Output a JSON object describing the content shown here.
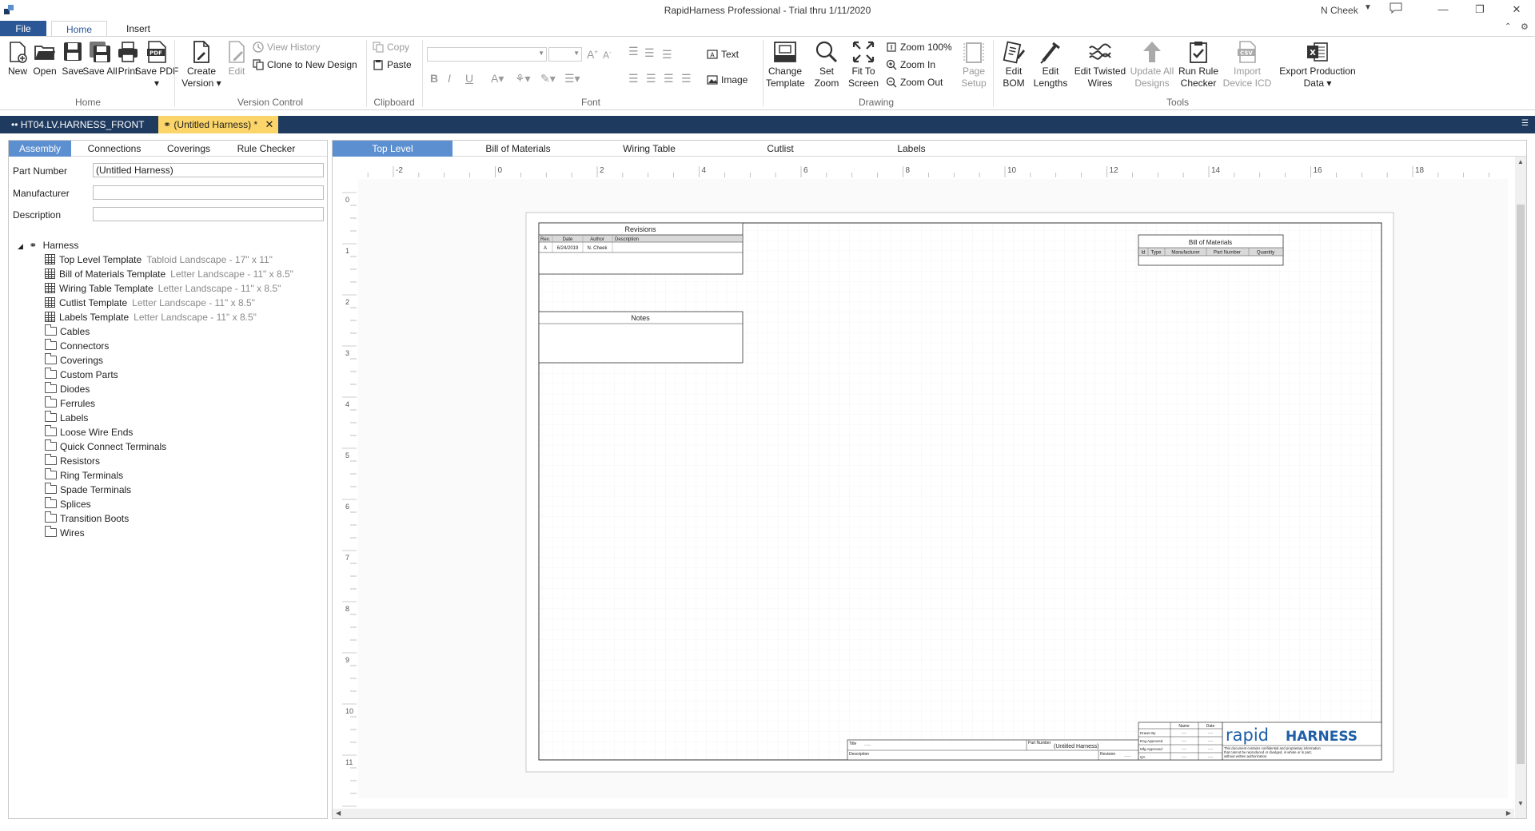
{
  "title": "RapidHarness Professional - Trial thru 1/11/2020",
  "user": "N Cheek",
  "ribbon_tabs": [
    "File",
    "Home",
    "Insert"
  ],
  "ribbon": {
    "home_group": {
      "label": "Home",
      "buttons": [
        "New",
        "Open",
        "Save",
        "Save All",
        "Print",
        "Save PDF ▾"
      ]
    },
    "version_group": {
      "label": "Version Control",
      "create_version": "Create Version ▾",
      "edit": "Edit",
      "view_history": "View History",
      "clone": "Clone to New Design"
    },
    "clipboard_group": {
      "label": "Clipboard",
      "copy": "Copy",
      "paste": "Paste"
    },
    "font_group": {
      "label": "Font",
      "text": "Text",
      "image": "Image"
    },
    "drawing_group": {
      "label": "Drawing",
      "change_template": "Change Template",
      "set_zoom": "Set Zoom",
      "fit_to_screen": "Fit To Screen",
      "zoom_100": "Zoom 100%",
      "zoom_in": "Zoom In",
      "zoom_out": "Zoom Out",
      "page_setup": "Page Setup"
    },
    "tools_group": {
      "label": "Tools",
      "edit_bom": "Edit BOM",
      "edit_lengths": "Edit Lengths",
      "edit_twisted": "Edit Twisted Wires",
      "update_all": "Update All Designs",
      "run_rule": "Run Rule Checker",
      "import_icd": "Import Device ICD",
      "export": "Export Production Data ▾"
    }
  },
  "doc_tabs": [
    {
      "label": "HT04.LV.HARNESS_FRONT",
      "active": false
    },
    {
      "label": "(Untitled Harness) *",
      "active": true
    }
  ],
  "left_panel": {
    "tabs": [
      "Assembly",
      "Connections",
      "Coverings",
      "Rule Checker"
    ],
    "fields": {
      "part_number_label": "Part Number",
      "part_number_value": "(Untitled Harness)",
      "manufacturer_label": "Manufacturer",
      "manufacturer_value": "",
      "description_label": "Description",
      "description_value": ""
    },
    "tree": {
      "root": "Harness",
      "templates": [
        {
          "label": "Top Level Template",
          "sub": "Tabloid Landscape - 17\" x 11\""
        },
        {
          "label": "Bill of Materials Template",
          "sub": "Letter Landscape - 11\" x 8.5\""
        },
        {
          "label": "Wiring Table Template",
          "sub": "Letter Landscape - 11\" x 8.5\""
        },
        {
          "label": "Cutlist Template",
          "sub": "Letter Landscape - 11\" x 8.5\""
        },
        {
          "label": "Labels Template",
          "sub": "Letter Landscape - 11\" x 8.5\""
        }
      ],
      "folders": [
        "Cables",
        "Connectors",
        "Coverings",
        "Custom Parts",
        "Diodes",
        "Ferrules",
        "Labels",
        "Loose Wire Ends",
        "Quick Connect Terminals",
        "Resistors",
        "Ring Terminals",
        "Spade Terminals",
        "Splices",
        "Transition Boots",
        "Wires"
      ]
    }
  },
  "view_tabs": [
    "Top Level",
    "Bill of Materials",
    "Wiring Table",
    "Cutlist",
    "Labels"
  ],
  "ruler": {
    "h_labels": [
      "-2",
      "0",
      "2",
      "4",
      "6",
      "8",
      "10",
      "12",
      "14",
      "16",
      "18"
    ],
    "v_labels": [
      "0",
      "1",
      "2",
      "3",
      "4",
      "5",
      "6",
      "7",
      "8",
      "9",
      "10",
      "11"
    ]
  },
  "sheet": {
    "revisions": {
      "title": "Revisions",
      "headers": [
        "Rev.",
        "Date",
        "Author",
        "Description"
      ],
      "rows": [
        [
          "A",
          "6/24/2019",
          "N. Cheek",
          ""
        ]
      ]
    },
    "notes_title": "Notes",
    "bom": {
      "title": "Bill of Materials",
      "headers": [
        "Id",
        "Type",
        "Manufacturer",
        "Part Number",
        "Quantity"
      ]
    },
    "titleblock": {
      "title_label": "Title",
      "title_value": "-----",
      "description_label": "Description",
      "part_number_label": "Part Number",
      "part_number_value": "(Untitled Harness)",
      "revision_label": "Revision",
      "revision_value": "-----",
      "name_header": "Name",
      "date_header": "Date",
      "rows": [
        "Drawn By",
        "Eng Approved",
        "Mfg Approved",
        "QA"
      ],
      "placeholder": "----",
      "logo_left": "rapid",
      "logo_right": "HARNESS",
      "disclaimer": [
        "This document contains confidential and proprietary information",
        "that cannot be reproduced or divulged, in whole or in part,",
        "without written authorization."
      ]
    }
  },
  "colors": {
    "file_tab": "#2b5797",
    "doc_tabbar": "#1f3a5f",
    "active_doc_tab": "#fbd56a",
    "active_panel_tab": "#5b8fd0",
    "logo_blue": "#1f5fa8"
  }
}
